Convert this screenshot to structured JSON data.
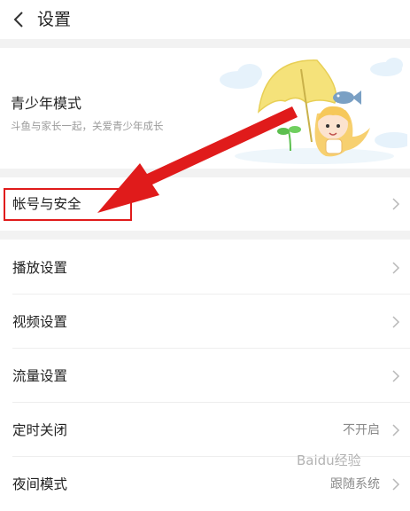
{
  "header": {
    "back_icon": "chevron-left-icon",
    "title": "设置"
  },
  "youth_mode": {
    "title": "青少年模式",
    "subtitle": "斗鱼与家长一起，关爱青少年成长"
  },
  "rows": [
    {
      "label": "帐号与安全",
      "value": ""
    },
    {
      "label": "播放设置",
      "value": ""
    },
    {
      "label": "视频设置",
      "value": ""
    },
    {
      "label": "流量设置",
      "value": ""
    },
    {
      "label": "定时关闭",
      "value": "不开启"
    },
    {
      "label": "夜间模式",
      "value": "跟随系统"
    }
  ],
  "watermark": "Baidu经验",
  "colors": {
    "annotation_red": "#e01b1b",
    "section_gap": "#f2f2f2",
    "umbrella_yellow": "#f5e27a"
  }
}
